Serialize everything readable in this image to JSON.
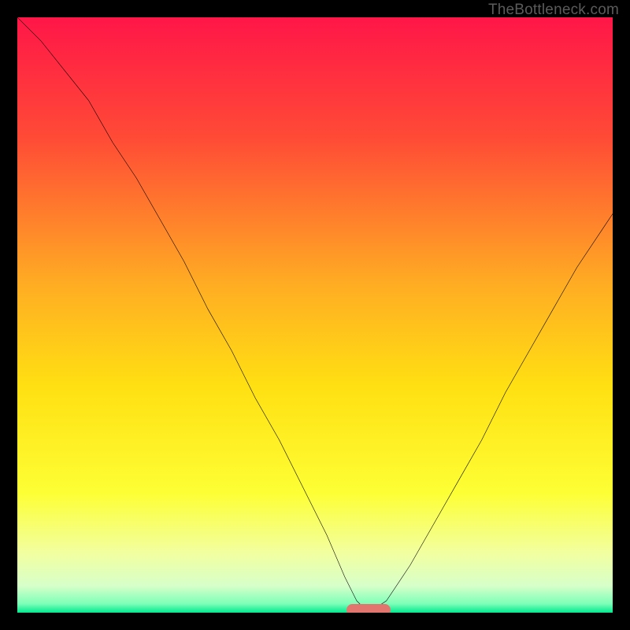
{
  "watermark": {
    "text": "TheBottleneck.com"
  },
  "colors": {
    "frame": "#000000",
    "curve": "#000000",
    "marker": "#e2766e",
    "gradient_stops": [
      {
        "offset": 0.0,
        "color": "#ff1648"
      },
      {
        "offset": 0.2,
        "color": "#ff4a36"
      },
      {
        "offset": 0.45,
        "color": "#ffad23"
      },
      {
        "offset": 0.62,
        "color": "#ffe012"
      },
      {
        "offset": 0.8,
        "color": "#fdff35"
      },
      {
        "offset": 0.9,
        "color": "#f2ffa0"
      },
      {
        "offset": 0.955,
        "color": "#d7ffc9"
      },
      {
        "offset": 0.985,
        "color": "#7dffb8"
      },
      {
        "offset": 1.0,
        "color": "#00e88e"
      }
    ]
  },
  "chart_data": {
    "type": "line",
    "title": "",
    "xlabel": "",
    "ylabel": "",
    "xlim": [
      0,
      100
    ],
    "ylim": [
      0,
      100
    ],
    "series": [
      {
        "name": "bottleneck-curve",
        "x": [
          0,
          4,
          8,
          12,
          16,
          20,
          24,
          28,
          32,
          36,
          40,
          44,
          48,
          52,
          55,
          57,
          59,
          62,
          66,
          70,
          74,
          78,
          82,
          86,
          90,
          94,
          98,
          100
        ],
        "y": [
          100,
          96,
          91,
          86,
          79,
          73,
          66,
          59,
          51,
          44,
          36,
          29,
          21,
          13,
          6,
          2,
          0,
          2,
          8,
          15,
          22,
          29,
          37,
          44,
          51,
          58,
          64,
          67
        ]
      }
    ],
    "annotations": [
      {
        "name": "optimal-marker",
        "shape": "rounded-rect",
        "x_center": 59,
        "y_center": 0.5,
        "width_pct": 7.5,
        "height_pct": 2.0
      }
    ],
    "notes": "x = position along horizontal axis (percent of plot width). y = bottleneck percentage (0 at bottom, 100 at top). Background gradient encodes severity: red (high) at top through yellow to green (low) at bottom. Black curve shows a V-shaped minimum near x≈59."
  }
}
